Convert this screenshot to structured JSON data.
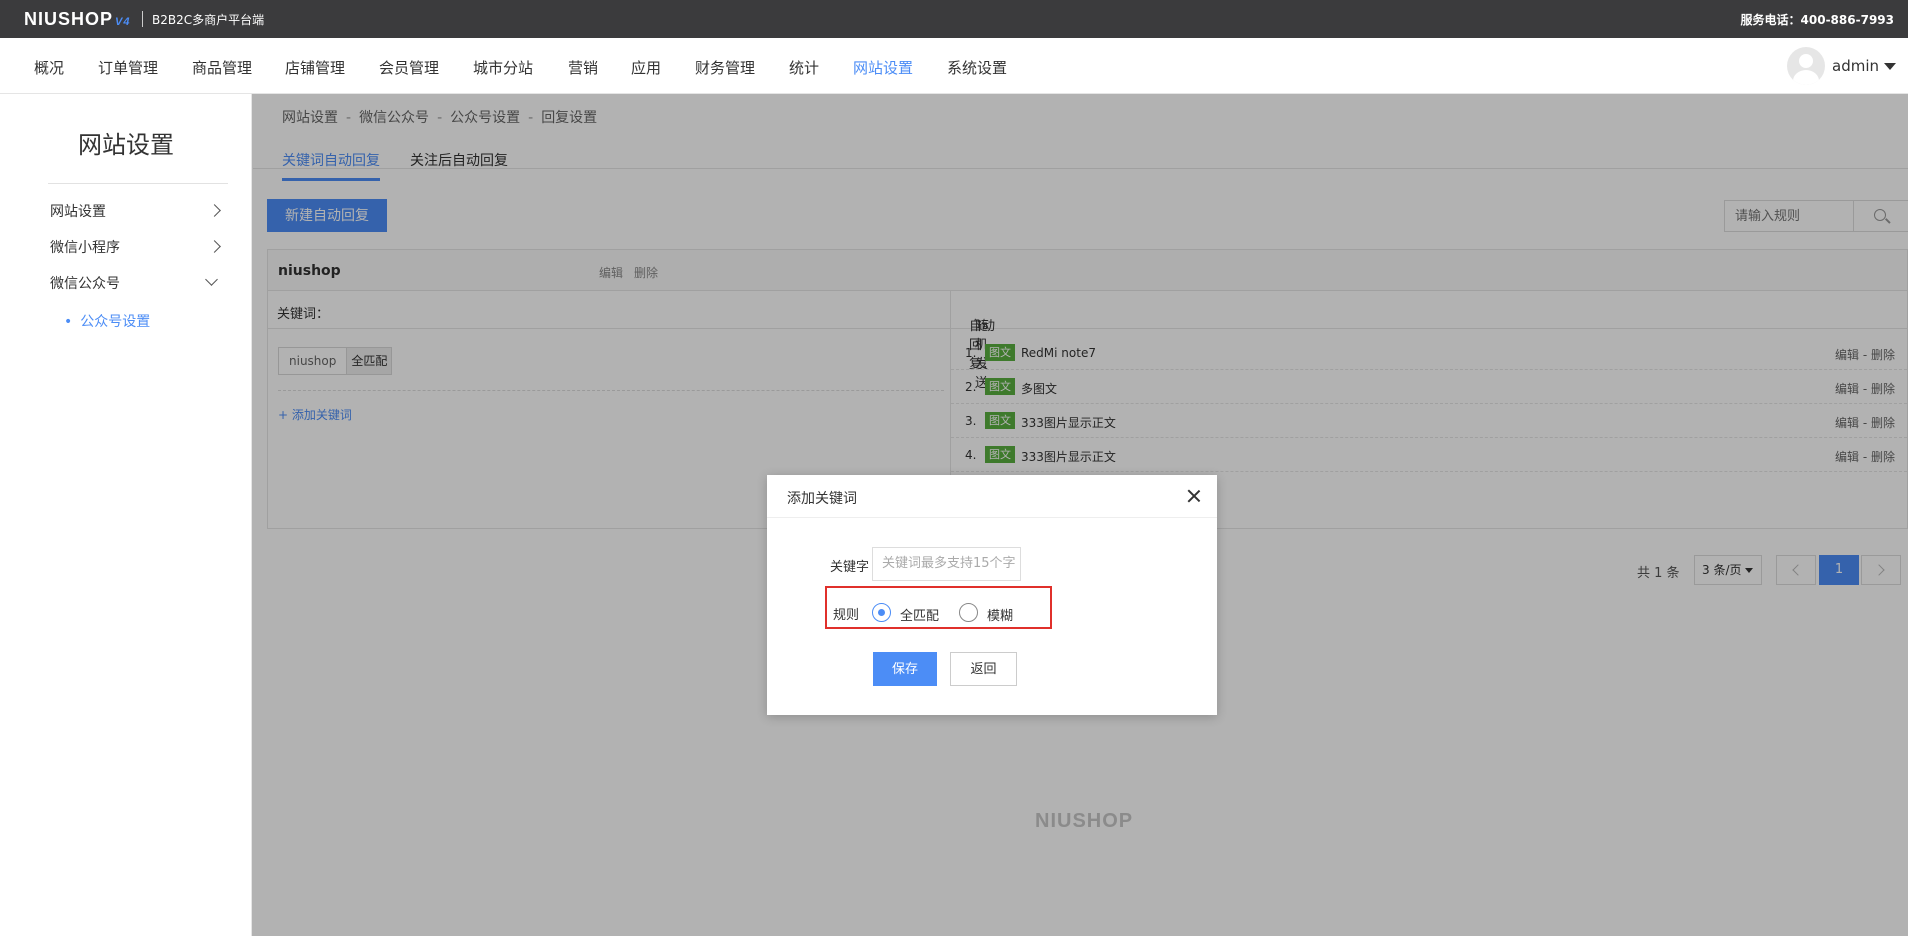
{
  "topbar": {
    "logo_text": "NIUSHOP",
    "logo_version": "V4",
    "platform": "B2B2C多商户平台端",
    "phone": "服务电话：400-886-7993"
  },
  "nav": {
    "items": [
      "概况",
      "订单管理",
      "商品管理",
      "店铺管理",
      "会员管理",
      "城市分站",
      "营销",
      "应用",
      "财务管理",
      "统计",
      "网站设置",
      "系统设置"
    ],
    "active": "网站设置",
    "username": "admin"
  },
  "sidebar": {
    "title": "网站设置",
    "items": [
      {
        "label": "网站设置",
        "chevron": "right"
      },
      {
        "label": "微信小程序",
        "chevron": "right"
      },
      {
        "label": "微信公众号",
        "chevron": "down"
      }
    ],
    "sub_item": "公众号设置"
  },
  "breadcrumb": {
    "items": [
      "网站设置",
      "微信公众号",
      "公众号设置",
      "回复设置"
    ],
    "separator": "-"
  },
  "tabs": {
    "items": [
      "关键词自动回复",
      "关注后自动回复"
    ],
    "active_index": 0
  },
  "toolbar": {
    "new_button": "新建自动回复",
    "search_placeholder": "请输入规则"
  },
  "rule": {
    "name": "niushop",
    "edit": "编辑",
    "delete": "删除",
    "keyword_header": "关键词：",
    "keyword": "niushop",
    "match": "全匹配",
    "add_keyword": "+ 添加关键词",
    "reply_header": "自动回复：",
    "reply_mode": "随机发送",
    "replies": [
      {
        "num": "1.",
        "type": "图文",
        "title": "RedMi note7",
        "actions": "编辑 - 删除"
      },
      {
        "num": "2.",
        "type": "图文",
        "title": "多图文",
        "actions": "编辑 - 删除"
      },
      {
        "num": "3.",
        "type": "图文",
        "title": "333图片显示正文",
        "actions": "编辑 - 删除"
      },
      {
        "num": "4.",
        "type": "图文",
        "title": "333图片显示正文",
        "actions": "编辑 - 删除"
      }
    ]
  },
  "pagination": {
    "total": "共 1 条",
    "page_size": "3 条/页",
    "current_page": "1"
  },
  "watermark": "NIUSHOP",
  "modal": {
    "title": "添加关键词",
    "keyword_label": "关键字",
    "keyword_placeholder": "关键词最多支持15个字",
    "rule_label": "规则",
    "options": [
      "全匹配",
      "模糊"
    ],
    "selected_option": 0,
    "save": "保存",
    "back": "返回"
  },
  "colors": {
    "accent": "#4c8df6",
    "topbar_bg": "#3b3b3d",
    "badge": "#5aaf3f",
    "highlight_box": "#e0302b"
  }
}
